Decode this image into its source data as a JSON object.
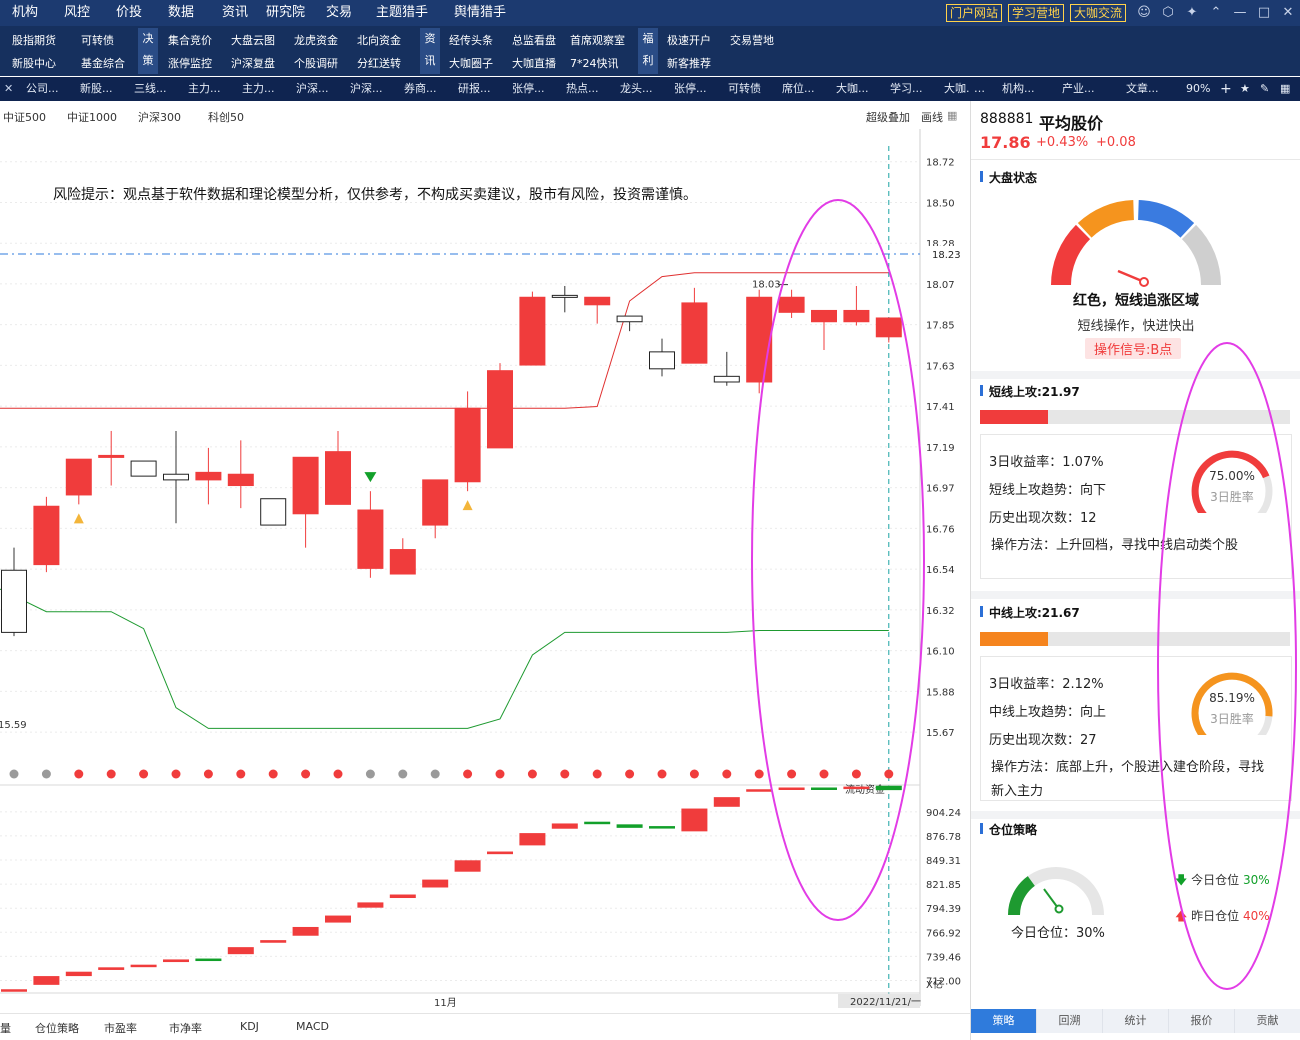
{
  "top_menu": [
    "机构",
    "风控",
    "价投",
    "数据",
    "资讯",
    "研究院",
    "交易",
    "主题猎手",
    "舆情猎手"
  ],
  "top_links": [
    "门户网站",
    "学习营地",
    "大咖交流"
  ],
  "func_cols": [
    {
      "top": "股指期货",
      "bottom": "新股中心"
    },
    {
      "top": "可转债",
      "bottom": "基金综合"
    },
    {
      "cat": [
        "决",
        "策"
      ]
    },
    {
      "top": "集合竞价",
      "bottom": "涨停监控"
    },
    {
      "top": "大盘云图",
      "bottom": "沪深复盘"
    },
    {
      "top": "龙虎资金",
      "bottom": "个股调研"
    },
    {
      "top": "北向资金",
      "bottom": "分红送转"
    },
    {
      "cat": [
        "资",
        "讯"
      ]
    },
    {
      "top": "经传头条",
      "bottom": "大咖圈子"
    },
    {
      "top": "总监看盘",
      "bottom": "大咖直播"
    },
    {
      "top": "首席观察室",
      "bottom": "7*24快讯"
    },
    {
      "cat": [
        "福",
        "利"
      ]
    },
    {
      "top": "极速开户",
      "bottom": "新客推荐"
    },
    {
      "top": "交易营地",
      "bottom": ""
    }
  ],
  "tabs": [
    "公司...",
    "新股...",
    "三线...",
    "主力...",
    "主力...",
    "沪深...",
    "沪深...",
    "券商...",
    "研报...",
    "张停...",
    "热点...",
    "龙头...",
    "张停...",
    "可转债",
    "席位...",
    "大咖...",
    "学习...",
    "大咖...",
    "机构...",
    "产业...",
    "文章..."
  ],
  "zoom": "90%",
  "index_tabs": [
    "中证500",
    "中证1000",
    "沪深300",
    "科创50"
  ],
  "chart_tools": [
    "超级叠加",
    "画线"
  ],
  "risk_note": "风险提示：观点基于软件数据和理论模型分析，仅供参考，不构成买卖建议，股市有风险，投资需谨慎。",
  "price_axis": [
    "18.72",
    "18.50",
    "18.28",
    "18.07",
    "17.85",
    "17.63",
    "17.41",
    "17.19",
    "16.97",
    "16.76",
    "16.54",
    "16.32",
    "16.10",
    "15.88",
    "15.67"
  ],
  "current_line_label": "18.23",
  "high_label": "18.03",
  "low_label": "15.59",
  "volume_axis": [
    "904.24",
    "876.78",
    "849.31",
    "821.85",
    "794.39",
    "766.92",
    "739.46",
    "712.00"
  ],
  "volume_unit": "X亿",
  "volume_title": "流动资金",
  "x_month": "11月",
  "x_date": "2022/11/21/一",
  "bottom_tabs": [
    "量",
    "仓位策略",
    "市盈率",
    "市净率",
    "KDJ",
    "MACD"
  ],
  "stock": {
    "code": "888881",
    "name": "平均股价",
    "price": "17.86",
    "pct": "+0.43%",
    "chg": "+0.08"
  },
  "market_state": {
    "title": "大盘状态",
    "headline": "红色，短线追涨区域",
    "desc": "短线操作，快进快出",
    "signal": "操作信号:B点"
  },
  "short_line": {
    "title": "短线上攻:21.97",
    "bar_pct": 0.22,
    "lines": [
      "3日收益率：1.07%",
      "短线上攻趋势：向下",
      "历史出现次数：12",
      "操作方法：上升回档，寻找中线启动类个股"
    ],
    "win_pct": "75.00%",
    "win_label": "3日胜率",
    "win_value": 0.75
  },
  "mid_line": {
    "title": "中线上攻:21.67",
    "bar_pct": 0.22,
    "lines": [
      "3日收益率：2.12%",
      "中线上攻趋势：向上",
      "历史出现次数：27",
      "操作方法：底部上升，个股进入建仓阶段，寻找",
      "新入主力"
    ],
    "win_pct": "85.19%",
    "win_label": "3日胜率",
    "win_value": 0.8519
  },
  "position": {
    "title": "仓位策略",
    "today_label": "今日仓位：30%",
    "today": "今日仓位",
    "today_val": "30%",
    "yesterday": "昨日仓位",
    "yesterday_val": "40%",
    "value": 0.3
  },
  "right_tabs": [
    "策略",
    "回溯",
    "统计",
    "报价",
    "贡献"
  ],
  "colors": {
    "up": "#f03c3c",
    "down": "#12a02a",
    "nav": "#1c3a70",
    "accent": "#2f7bdc",
    "magenta": "#e23ce6",
    "orange": "#f5841e"
  },
  "chart_data": {
    "type": "candlestick",
    "ylim": [
      15.59,
      18.83
    ],
    "candles": [
      {
        "o": 16.55,
        "c": 16.22,
        "h": 16.67,
        "l": 16.2
      },
      {
        "o": 16.58,
        "c": 16.89,
        "h": 16.94,
        "l": 16.54
      },
      {
        "o": 16.95,
        "c": 17.14,
        "h": 17.14,
        "l": 16.9
      },
      {
        "o": 17.16,
        "c": 17.16,
        "h": 17.29,
        "l": 17.0
      },
      {
        "o": 17.13,
        "c": 17.05,
        "h": 17.13,
        "l": 17.05
      },
      {
        "o": 17.06,
        "c": 17.03,
        "h": 17.29,
        "l": 16.8
      },
      {
        "o": 17.03,
        "c": 17.07,
        "h": 17.2,
        "l": 16.9
      },
      {
        "o": 17.0,
        "c": 17.06,
        "h": 17.24,
        "l": 16.88
      },
      {
        "o": 16.93,
        "c": 16.79,
        "h": 16.93,
        "l": 16.8
      },
      {
        "o": 16.85,
        "c": 17.15,
        "h": 17.15,
        "l": 16.67
      },
      {
        "o": 16.9,
        "c": 17.18,
        "h": 17.29,
        "l": 16.9
      },
      {
        "o": 16.56,
        "c": 16.87,
        "h": 16.97,
        "l": 16.51
      },
      {
        "o": 16.53,
        "c": 16.66,
        "h": 16.72,
        "l": 16.53
      },
      {
        "o": 16.79,
        "c": 17.03,
        "h": 17.03,
        "l": 16.72
      },
      {
        "o": 17.02,
        "c": 17.41,
        "h": 17.5,
        "l": 16.97
      },
      {
        "o": 17.2,
        "c": 17.61,
        "h": 17.65,
        "l": 17.2
      },
      {
        "o": 17.64,
        "c": 18.0,
        "h": 18.03,
        "l": 17.64
      },
      {
        "o": 18.01,
        "c": 18.0,
        "h": 18.06,
        "l": 17.92
      },
      {
        "o": 17.96,
        "c": 18.0,
        "h": 18.0,
        "l": 17.86
      },
      {
        "o": 17.9,
        "c": 17.87,
        "h": 17.9,
        "l": 17.82
      },
      {
        "o": 17.71,
        "c": 17.62,
        "h": 17.78,
        "l": 17.58
      },
      {
        "o": 17.65,
        "c": 17.97,
        "h": 18.05,
        "l": 17.65
      },
      {
        "o": 17.58,
        "c": 17.55,
        "h": 17.71,
        "l": 17.53
      },
      {
        "o": 17.55,
        "c": 18.0,
        "h": 18.04,
        "l": 17.49
      },
      {
        "o": 17.92,
        "c": 18.0,
        "h": 18.04,
        "l": 17.89
      },
      {
        "o": 17.87,
        "c": 17.93,
        "h": 17.93,
        "l": 17.72
      },
      {
        "o": 17.87,
        "c": 17.93,
        "h": 18.06,
        "l": 17.85
      },
      {
        "o": 17.79,
        "c": 17.89,
        "h": 17.89,
        "l": 17.76
      }
    ],
    "resistance": [
      17.41,
      17.41,
      17.41,
      17.41,
      17.41,
      17.41,
      17.41,
      17.41,
      17.41,
      17.41,
      17.41,
      17.41,
      17.41,
      17.41,
      17.41,
      17.41,
      17.41,
      17.41,
      17.42,
      17.98,
      18.11,
      18.13,
      18.13,
      18.13,
      18.13,
      18.13,
      18.13,
      18.13
    ],
    "support": [
      16.45,
      16.33,
      16.33,
      16.33,
      16.24,
      15.82,
      15.71,
      15.71,
      15.71,
      15.71,
      15.71,
      15.71,
      15.71,
      15.71,
      15.71,
      15.76,
      16.1,
      16.22,
      16.22,
      16.22,
      16.22,
      16.22,
      16.22,
      16.23,
      16.23,
      16.23,
      16.23,
      16.23
    ],
    "dot_colors": [
      "gray",
      "gray",
      "red",
      "red",
      "red",
      "red",
      "red",
      "red",
      "red",
      "red",
      "red",
      "gray",
      "gray",
      "gray",
      "red",
      "red",
      "red",
      "red",
      "red",
      "red",
      "red",
      "red",
      "red",
      "red",
      "red",
      "red",
      "red",
      "red"
    ],
    "markers": [
      {
        "i": 2,
        "t": "B"
      },
      {
        "i": 11,
        "t": "S"
      },
      {
        "i": 14,
        "t": "B"
      }
    ],
    "volume_ylim": [
      700,
      928
    ],
    "volume_up": [
      true,
      true,
      true,
      true,
      true,
      true,
      false,
      true,
      true,
      true,
      true,
      true,
      true,
      true,
      true,
      true,
      true,
      true,
      false,
      false,
      false,
      true,
      true,
      true,
      true,
      false,
      true,
      false
    ],
    "volume": [
      [
        702,
        700
      ],
      [
        707,
        717
      ],
      [
        717,
        722
      ],
      [
        724,
        727
      ],
      [
        729,
        730
      ],
      [
        733,
        736
      ],
      [
        736,
        737
      ],
      [
        742,
        750
      ],
      [
        755,
        758
      ],
      [
        763,
        773
      ],
      [
        778,
        786
      ],
      [
        795,
        801
      ],
      [
        806,
        810
      ],
      [
        818,
        827
      ],
      [
        836,
        849
      ],
      [
        856,
        859
      ],
      [
        866,
        880
      ],
      [
        885,
        891
      ],
      [
        891,
        893
      ],
      [
        886,
        890
      ],
      [
        887,
        888
      ],
      [
        882,
        908
      ],
      [
        910,
        921
      ],
      [
        928,
        930
      ],
      [
        931,
        932
      ],
      [
        932,
        931
      ],
      [
        933,
        932
      ],
      [
        929,
        934
      ]
    ]
  }
}
